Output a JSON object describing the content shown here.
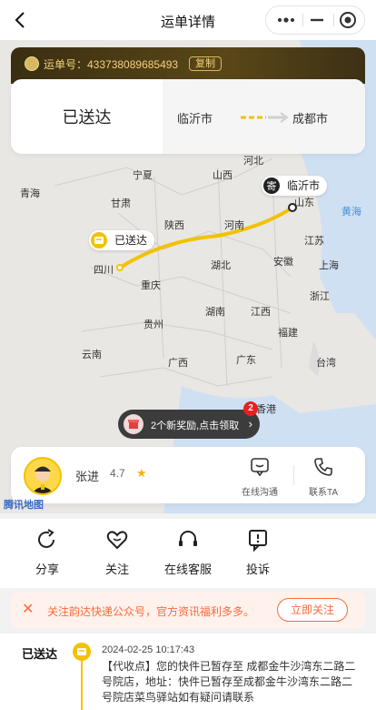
{
  "nav": {
    "title": "运单详情",
    "back_icon": "back-arrow-icon",
    "more_icon": "more-dots-icon",
    "minimize_icon": "minimize-icon",
    "close_icon": "target-close-icon"
  },
  "waybill": {
    "label": "运单号：433738089685493",
    "copy_label": "复制"
  },
  "status_card": {
    "status": "已送达",
    "from_city": "临沂市",
    "to_city": "成都市"
  },
  "map": {
    "provinces": [
      "河北",
      "山西",
      "宁夏",
      "甘肃",
      "青海",
      "陕西",
      "河南",
      "山东",
      "江苏",
      "安徽",
      "上海",
      "湖北",
      "四川",
      "重庆",
      "浙江",
      "湖南",
      "江西",
      "贵州",
      "福建",
      "云南",
      "广西",
      "广东",
      "台湾",
      "香港"
    ],
    "sea": "黄海",
    "origin_pin": "临沂市",
    "current_pin": "已送达",
    "logo_text": "腾讯地图",
    "route_color": "#f2c200"
  },
  "reward": {
    "text": "2个新奖励,点击领取",
    "badge": "2"
  },
  "courier": {
    "name": "张进",
    "rating": "4.7",
    "chat_label": "在线沟通",
    "call_label": "联系TA"
  },
  "actions": [
    {
      "label": "分享",
      "icon": "share-icon"
    },
    {
      "label": "关注",
      "icon": "heart-icon"
    },
    {
      "label": "在线客服",
      "icon": "headset-icon"
    },
    {
      "label": "投诉",
      "icon": "complaint-icon"
    }
  ],
  "follow_bar": {
    "text": "关注韵达快递公众号，官方资讯福利多多。",
    "button": "立即关注"
  },
  "timeline": {
    "status": "已送达",
    "time": "2024-02-25 10:17:43",
    "desc": "【代收点】您的快件已暂存至 成都金牛沙湾东二路二号院店，地址：快件已暂存至成都金牛沙湾东二路二号院店菜鸟驿站如有疑问请联系"
  }
}
